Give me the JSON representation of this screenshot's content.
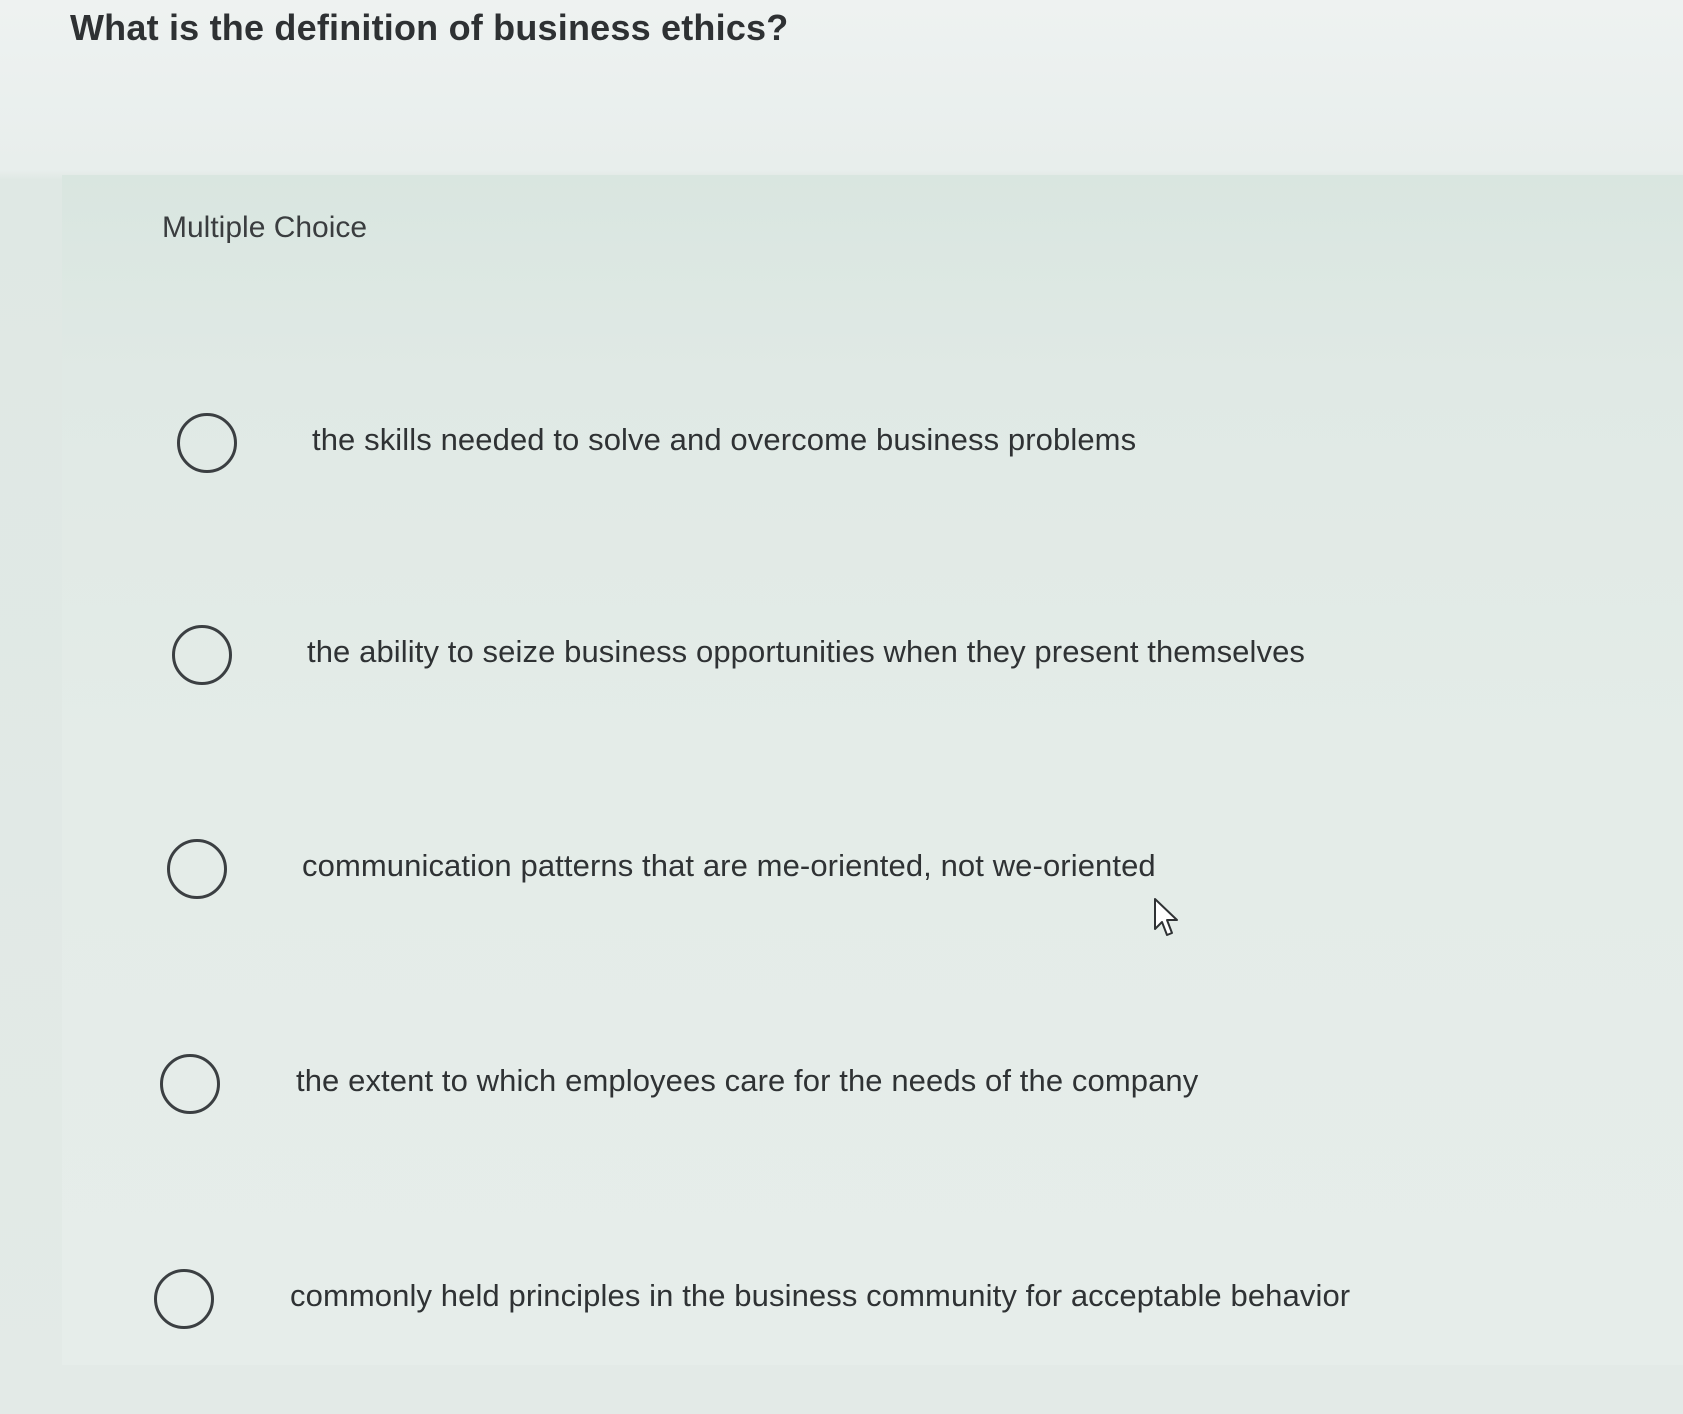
{
  "question": {
    "text": "What is the definition of business ethics?"
  },
  "panel": {
    "label": "Multiple Choice"
  },
  "options": [
    {
      "label": "the skills needed to solve and overcome business problems",
      "selected": false
    },
    {
      "label": "the ability to seize business opportunities when they present themselves",
      "selected": false
    },
    {
      "label": "communication patterns that are me-oriented, not we-oriented",
      "selected": false
    },
    {
      "label": "the extent to which employees care for the needs of the company",
      "selected": false
    },
    {
      "label": "commonly held principles in the business community for acceptable behavior",
      "selected": false
    }
  ],
  "icons": {
    "radio": "radio-unchecked-icon",
    "cursor": "mouse-pointer-icon"
  },
  "colors": {
    "background": "#e9eeec",
    "panel": "#e0e9e5",
    "text": "#2d2f31",
    "radio_border": "#3b3f42"
  }
}
